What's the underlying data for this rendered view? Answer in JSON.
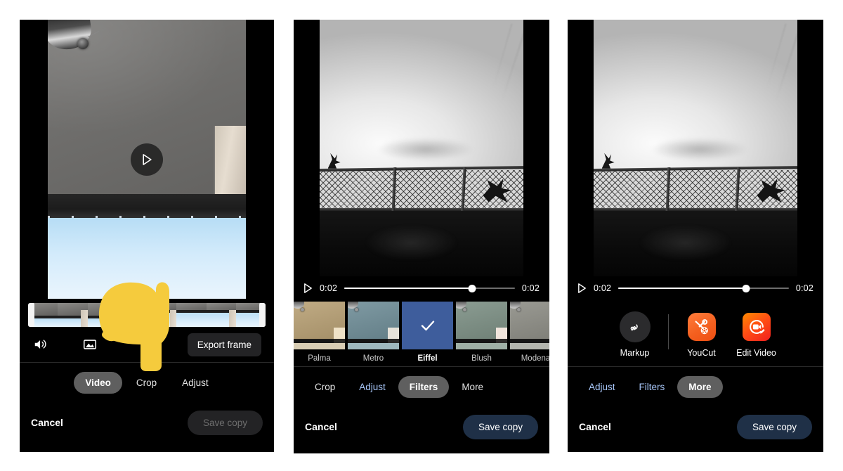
{
  "panels": [
    {
      "id": "video-tab-panel",
      "media": "room-corner-skylight-photo",
      "play_overlay_icon": "play-icon",
      "timeline": {
        "trim_left_handle": "trim-handle-left",
        "trim_right_handle": "trim-handle-right"
      },
      "tools": {
        "volume_icon": "volume-on-icon",
        "frame_icon": "export-frame-icon",
        "export_frame_label": "Export frame"
      },
      "tabs": [
        {
          "label": "Video",
          "state": "selected"
        },
        {
          "label": "Crop",
          "state": "normal"
        },
        {
          "label": "Adjust",
          "state": "normal"
        }
      ],
      "actions": {
        "cancel_label": "Cancel",
        "save_label": "Save copy",
        "save_state": "disabled"
      }
    },
    {
      "id": "filters-tab-panel",
      "media": "bw-chainlink-fence-photo",
      "playback": {
        "play_icon": "play-icon",
        "current_time": "0:02",
        "total_time": "0:02",
        "progress_percent": 75
      },
      "filters": [
        {
          "label": "Palma",
          "selected": false,
          "tint": "#c0ab84",
          "sky": "#d8cdb4",
          "pillar": "#efe2c7"
        },
        {
          "label": "Metro",
          "selected": false,
          "tint": "#7f9aa3",
          "sky": "#9fb9bf",
          "pillar": "#e6e2da"
        },
        {
          "label": "Eiffel",
          "selected": true,
          "tint": "#3e5d9c",
          "sky": "#3e5d9c",
          "pillar": "#3e5d9c"
        },
        {
          "label": "Blush",
          "selected": false,
          "tint": "#8b9c92",
          "sky": "#9fb0a6",
          "pillar": "#f0e4dc"
        },
        {
          "label": "Modena",
          "selected": false,
          "tint": "#9a9a93",
          "sky": "#b3b5ae",
          "pillar": "#eceade"
        }
      ],
      "selected_filter_check_icon": "check-icon",
      "tabs": [
        {
          "label": "Crop",
          "state": "normal"
        },
        {
          "label": "Adjust",
          "state": "edited"
        },
        {
          "label": "Filters",
          "state": "selected"
        },
        {
          "label": "More",
          "state": "normal"
        }
      ],
      "actions": {
        "cancel_label": "Cancel",
        "save_label": "Save copy",
        "save_state": "enabled"
      }
    },
    {
      "id": "more-tab-panel",
      "media": "bw-chainlink-fence-photo",
      "playback": {
        "play_icon": "play-icon",
        "current_time": "0:02",
        "total_time": "0:02",
        "progress_percent": 75
      },
      "more_apps": [
        {
          "label": "Markup",
          "icon": "markup-squiggle-icon"
        },
        {
          "label": "YouCut",
          "icon": "youcut-app-icon"
        },
        {
          "label": "Edit Video",
          "icon": "edit-video-app-icon"
        }
      ],
      "tabs": [
        {
          "label": "Adjust",
          "state": "edited"
        },
        {
          "label": "Filters",
          "state": "edited"
        },
        {
          "label": "More",
          "state": "selected"
        }
      ],
      "actions": {
        "cancel_label": "Cancel",
        "save_label": "Save copy",
        "save_state": "enabled"
      }
    }
  ],
  "cursor": {
    "type": "pointing-hand-cursor",
    "color": "#f5cb3d"
  },
  "colors": {
    "background": "#000000",
    "accent_blue": "#a8c7fa",
    "selected_chip": "#5f5f5f",
    "save_enabled": "#1f3047",
    "filter_selected": "#3e5d9c"
  }
}
